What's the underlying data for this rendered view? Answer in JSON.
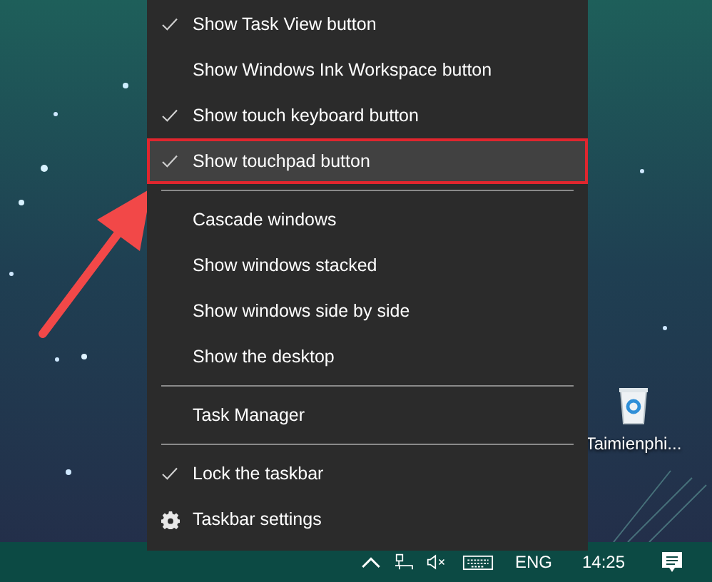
{
  "context_menu": {
    "items": [
      {
        "kind": "toggle",
        "label": "Show Task View button",
        "checked": true,
        "highlighted": false
      },
      {
        "kind": "toggle",
        "label": "Show Windows Ink Workspace button",
        "checked": false,
        "highlighted": false
      },
      {
        "kind": "toggle",
        "label": "Show touch keyboard button",
        "checked": true,
        "highlighted": false
      },
      {
        "kind": "toggle",
        "label": "Show touchpad button",
        "checked": true,
        "highlighted": true
      },
      {
        "kind": "separator"
      },
      {
        "kind": "action",
        "label": "Cascade windows",
        "highlighted": false
      },
      {
        "kind": "action",
        "label": "Show windows stacked",
        "highlighted": false
      },
      {
        "kind": "action",
        "label": "Show windows side by side",
        "highlighted": false
      },
      {
        "kind": "action",
        "label": "Show the desktop",
        "highlighted": false
      },
      {
        "kind": "separator"
      },
      {
        "kind": "action",
        "label": "Task Manager",
        "highlighted": false
      },
      {
        "kind": "separator"
      },
      {
        "kind": "toggle",
        "label": "Lock the taskbar",
        "checked": true,
        "highlighted": false
      },
      {
        "kind": "settings",
        "label": "Taskbar settings",
        "highlighted": false
      }
    ]
  },
  "desktop_icons": [
    {
      "label": "Taimienphi..."
    }
  ],
  "taskbar": {
    "language": "ENG",
    "time": "14:25"
  }
}
